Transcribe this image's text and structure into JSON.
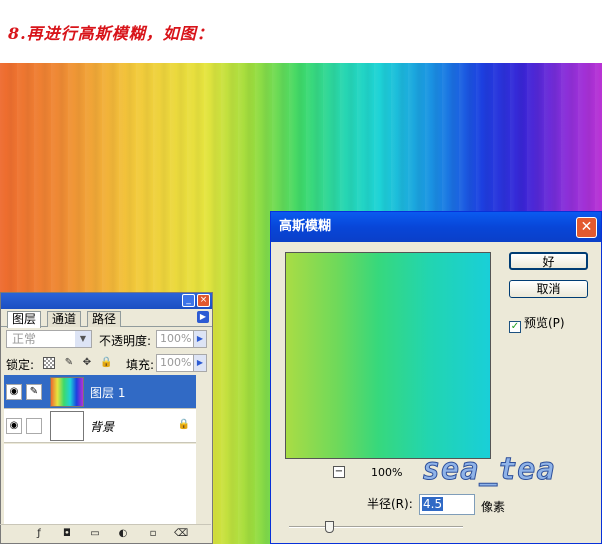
{
  "caption": "8.再进行高斯模糊，如图：",
  "layers_panel": {
    "tabs": [
      "图层",
      "通道",
      "路径"
    ],
    "blend_mode": "正常",
    "opacity_label": "不透明度:",
    "opacity_value": "100%",
    "lock_label": "锁定:",
    "fill_label": "填充:",
    "fill_value": "100%",
    "layers": [
      {
        "name": "图层 1",
        "selected": true
      },
      {
        "name": "背景",
        "selected": false
      }
    ]
  },
  "dialog": {
    "title": "高斯模糊",
    "ok_label": "好",
    "cancel_label": "取消",
    "preview_label": "预览(P)",
    "preview_checked": "✓",
    "zoom_minus": "−",
    "zoom_level": "100%",
    "radius_label": "半径(R):",
    "radius_value": "4.5",
    "radius_unit": "像素"
  },
  "watermark": "sea_tea",
  "icons": [
    "minimize-icon",
    "close-icon",
    "eye-icon",
    "brush-icon",
    "lock-icon",
    "move-icon",
    "chain-icon"
  ]
}
